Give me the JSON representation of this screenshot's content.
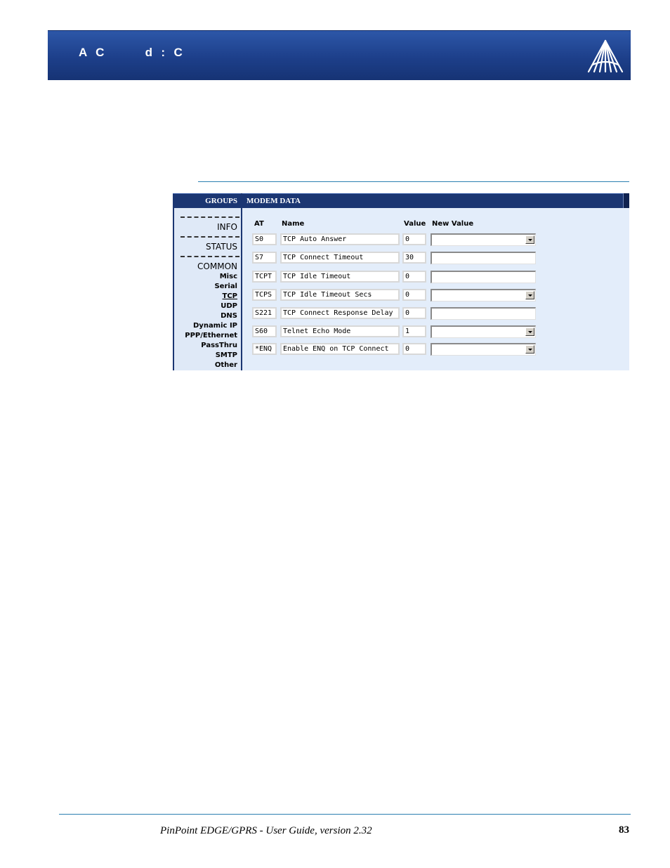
{
  "header": {
    "title": "A  C          d  :  C"
  },
  "panel": {
    "groups_label": "GROUPS",
    "modem_data_label": "MODEM DATA",
    "sidebar": {
      "separator": "--------------",
      "items": [
        {
          "label": "INFO",
          "kind": "major"
        },
        {
          "label": "STATUS",
          "kind": "major"
        },
        {
          "label": "COMMON",
          "kind": "major"
        },
        {
          "label": "Misc",
          "kind": "minor"
        },
        {
          "label": "Serial",
          "kind": "minor"
        },
        {
          "label": "TCP",
          "kind": "minor",
          "active": true
        },
        {
          "label": "UDP",
          "kind": "minor"
        },
        {
          "label": "DNS",
          "kind": "minor"
        },
        {
          "label": "Dynamic IP",
          "kind": "minor"
        },
        {
          "label": "PPP/Ethernet",
          "kind": "minor"
        },
        {
          "label": "PassThru",
          "kind": "minor"
        },
        {
          "label": "SMTP",
          "kind": "minor"
        },
        {
          "label": "Other",
          "kind": "minor"
        }
      ]
    },
    "columns": {
      "at": "AT",
      "name": "Name",
      "value": "Value",
      "new_value": "New Value"
    },
    "rows": [
      {
        "at": "S0",
        "name": "TCP Auto Answer",
        "value": "0",
        "new_value": "",
        "control": "select"
      },
      {
        "at": "S7",
        "name": "TCP Connect Timeout",
        "value": "30",
        "new_value": "",
        "control": "text"
      },
      {
        "at": "TCPT",
        "name": "TCP Idle Timeout",
        "value": "0",
        "new_value": "",
        "control": "text"
      },
      {
        "at": "TCPS",
        "name": "TCP Idle Timeout Secs",
        "value": "0",
        "new_value": "",
        "control": "select"
      },
      {
        "at": "S221",
        "name": "TCP Connect Response Delay",
        "value": "0",
        "new_value": "",
        "control": "text"
      },
      {
        "at": "S60",
        "name": "Telnet Echo Mode",
        "value": "1",
        "new_value": "",
        "control": "select"
      },
      {
        "at": "*ENQ",
        "name": "Enable ENQ on TCP Connect",
        "value": "0",
        "new_value": "",
        "control": "select"
      }
    ]
  },
  "footer": {
    "text": "PinPoint EDGE/GPRS - User Guide, version 2.32",
    "page_number": "83"
  },
  "colors": {
    "banner": "#1d3f8a",
    "panel_header": "#1b3672",
    "panel_bg": "#e3edfa",
    "rule": "#2b7fb0"
  }
}
